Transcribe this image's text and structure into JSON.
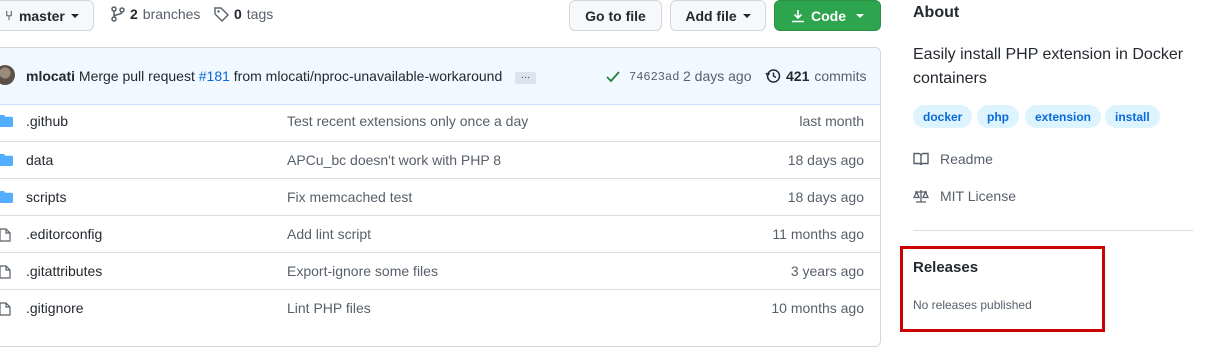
{
  "toolbar": {
    "branch_label": "master",
    "branches_count": "2",
    "branches_label": "branches",
    "tags_count": "0",
    "tags_label": "tags",
    "go_to_file": "Go to file",
    "add_file": "Add file",
    "code": "Code"
  },
  "commit": {
    "author": "mlocati",
    "message_prefix": "Merge pull request",
    "pr_link": "#181",
    "message_suffix": "from mlocati/nproc-unavailable-workaround",
    "ellipsis": "…",
    "sha": "74623ad",
    "time": "2 days ago",
    "commits_count": "421",
    "commits_label": "commits"
  },
  "files": [
    {
      "type": "dir",
      "name": ".github",
      "message": "Test recent extensions only once a day",
      "age": "last month"
    },
    {
      "type": "dir",
      "name": "data",
      "message": "APCu_bc doesn't work with PHP 8",
      "age": "18 days ago"
    },
    {
      "type": "dir",
      "name": "scripts",
      "message": "Fix memcached test",
      "age": "18 days ago"
    },
    {
      "type": "file",
      "name": ".editorconfig",
      "message": "Add lint script",
      "age": "11 months ago"
    },
    {
      "type": "file",
      "name": ".gitattributes",
      "message": "Export-ignore some files",
      "age": "3 years ago"
    },
    {
      "type": "file",
      "name": ".gitignore",
      "message": "Lint PHP files",
      "age": "10 months ago"
    }
  ],
  "about": {
    "heading": "About",
    "description_line1": "Easily install PHP extension in Docker",
    "description_line2": "containers",
    "topics": [
      "docker",
      "php",
      "extension",
      "install"
    ],
    "readme": "Readme",
    "license": "MIT License"
  },
  "releases": {
    "heading": "Releases",
    "empty_text": "No releases published"
  },
  "colors": {
    "accent": "#0969da",
    "code_button": "#2da44e",
    "highlight_box": "#cc0000"
  }
}
